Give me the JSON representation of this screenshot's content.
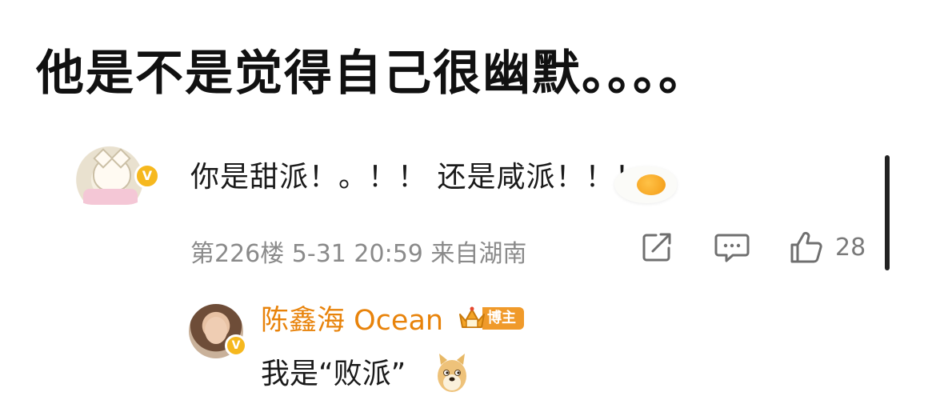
{
  "post": {
    "headline": "他是不是觉得自己很幽默。。。。"
  },
  "comment": {
    "text": "你是甜派！。！！ 还是咸派！！！",
    "badge": "V",
    "floor_time_location": "第226楼 5-31 20:59 来自湖南",
    "like_count": "28",
    "sticker": "fried-egg-sticker",
    "colors": {
      "meta": "#8a8a8a",
      "badge": "#f6b81e"
    }
  },
  "reply": {
    "author": "陈鑫海 Ocean",
    "author_tag": "博主",
    "badge": "V",
    "text": "我是“败派”",
    "sticker": "doge-sticker",
    "colors": {
      "author": "#e8830b",
      "tag": "#f09a2a"
    }
  },
  "icons": {
    "share": "share-edit-icon",
    "comment": "comment-bubble-icon",
    "like": "thumbs-up-icon"
  }
}
